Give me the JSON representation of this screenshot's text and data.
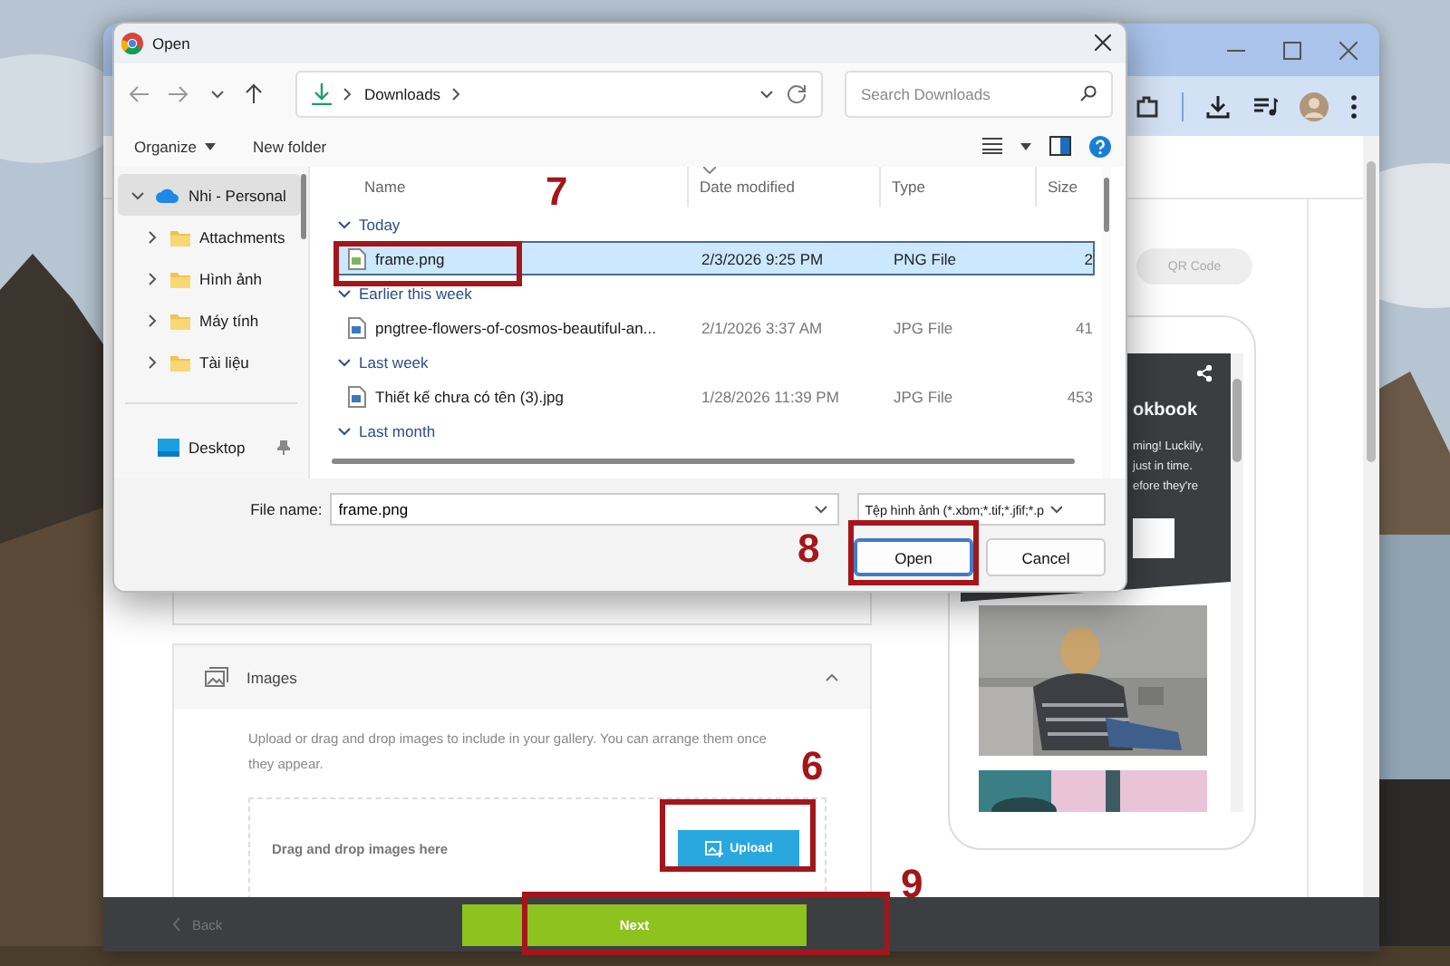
{
  "browser": {
    "page": {
      "images_section": {
        "title": "Images",
        "expanded": true,
        "description": "Upload or drag and drop images to include in your gallery. You can arrange them once they appear.",
        "drop_hint": "Drag and drop images here",
        "upload_button": "Upload"
      },
      "preview": {
        "qr_button": "QR Code",
        "heading": "okbook",
        "text_lines": [
          "ming! Luckily,",
          "just in time.",
          "efore they're"
        ]
      }
    },
    "footer": {
      "back": "Back",
      "next": "Next"
    }
  },
  "dialog": {
    "title": "Open",
    "address": {
      "segments": [
        "Downloads"
      ]
    },
    "search": {
      "placeholder": "Search Downloads"
    },
    "commands": [
      "Organize",
      "New folder"
    ],
    "nav": {
      "tree": [
        {
          "label": "Nhi - Personal",
          "selected": true,
          "expanded": true,
          "children": [
            {
              "label": "Attachments",
              "selected": false,
              "expanded": false
            },
            {
              "label": "Hình ảnh",
              "selected": false,
              "expanded": false
            },
            {
              "label": "Máy tính",
              "selected": false,
              "expanded": false
            },
            {
              "label": "Tài liệu",
              "selected": false,
              "expanded": false
            }
          ]
        }
      ],
      "pinned": [
        {
          "label": "Desktop",
          "selected": false
        }
      ]
    },
    "columns": [
      "Name",
      "Date modified",
      "Type",
      "Size"
    ],
    "groups": [
      {
        "label": "Today",
        "rows": [
          {
            "name": "frame.png",
            "date": "2/3/2026 9:25 PM",
            "type": "PNG File",
            "size": "2",
            "selected": true
          }
        ]
      },
      {
        "label": "Earlier this week",
        "rows": [
          {
            "name": "pngtree-flowers-of-cosmos-beautiful-an...",
            "date": "2/1/2026 3:37 AM",
            "type": "JPG File",
            "size": "41",
            "selected": false
          }
        ]
      },
      {
        "label": "Last week",
        "rows": [
          {
            "name": "Thiết kế chưa có tên (3).jpg",
            "date": "1/28/2026 11:39 PM",
            "type": "JPG File",
            "size": "453",
            "selected": false
          }
        ]
      },
      {
        "label": "Last month"
      }
    ],
    "file_name": {
      "label": "File name:",
      "value": "frame.png"
    },
    "file_type": "Tệp hình ảnh (*.xbm;*.tif;*.jfif;*.p",
    "buttons": [
      {
        "label": "Open",
        "default": true
      },
      {
        "label": "Cancel",
        "default": false
      }
    ]
  },
  "step_markers": [
    {
      "label": "7",
      "kind": "file-row"
    },
    {
      "label": "8",
      "kind": "open-button"
    },
    {
      "label": "6",
      "kind": "upload-button"
    },
    {
      "label": "9",
      "kind": "next-button"
    }
  ]
}
